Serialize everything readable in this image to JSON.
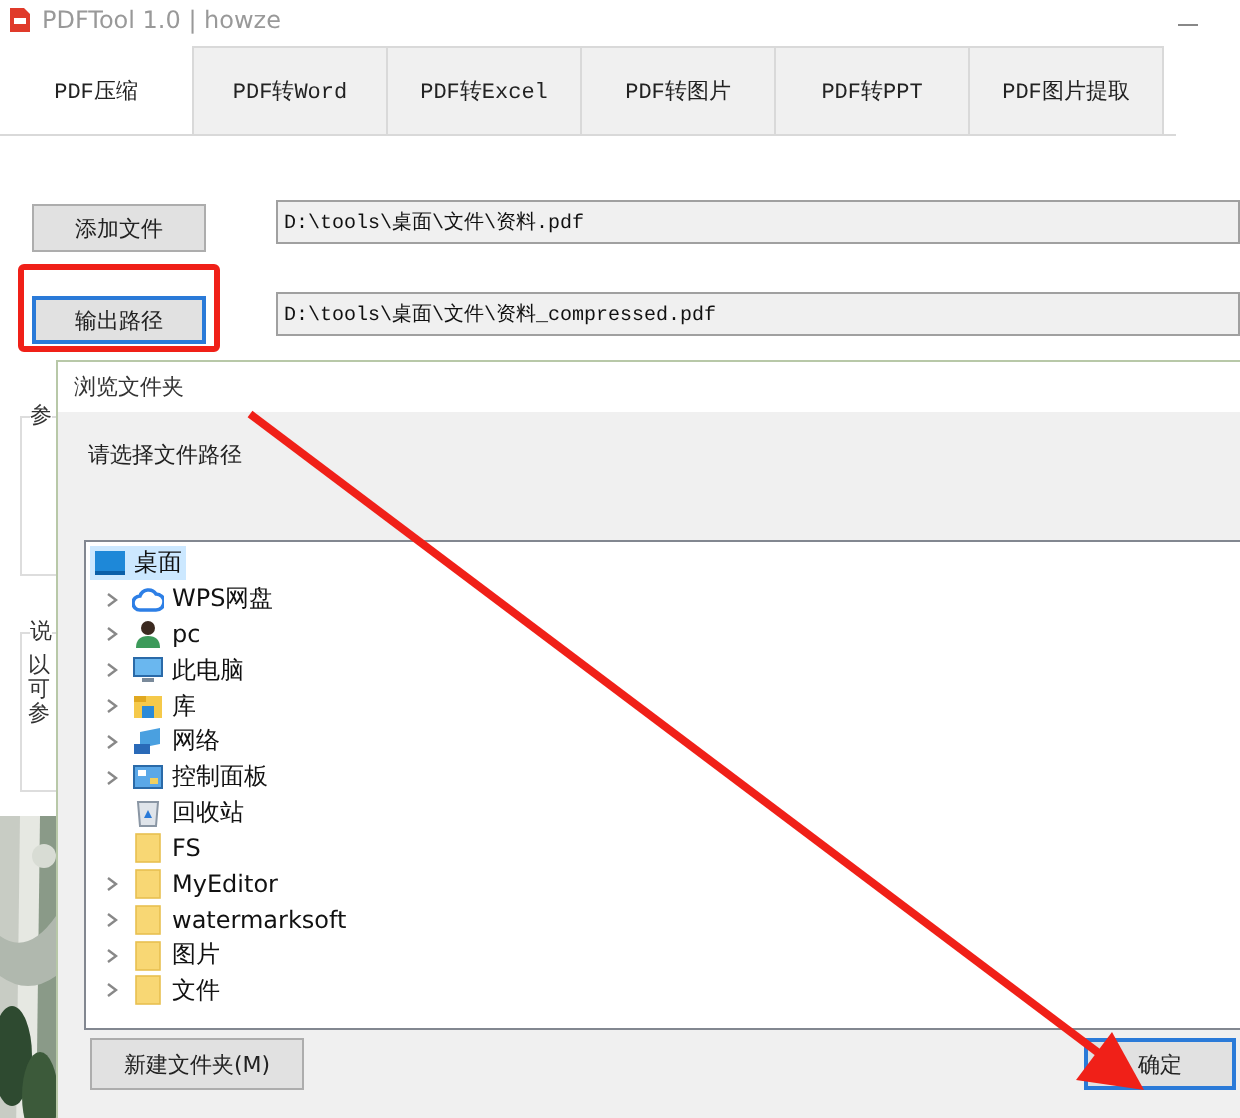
{
  "window": {
    "title": "PDFTool 1.0 | howze"
  },
  "tabs": [
    {
      "label": "PDF压缩",
      "selected": true
    },
    {
      "label": "PDF转Word",
      "selected": false
    },
    {
      "label": "PDF转Excel",
      "selected": false
    },
    {
      "label": "PDF转图片",
      "selected": false
    },
    {
      "label": "PDF转PPT",
      "selected": false
    },
    {
      "label": "PDF图片提取",
      "selected": false
    }
  ],
  "file_rows": [
    {
      "button": {
        "label": "添加文件",
        "focused": false
      },
      "path": "D:\\tools\\桌面\\文件\\资料.pdf"
    },
    {
      "button": {
        "label": "输出路径",
        "focused": true
      },
      "path": "D:\\tools\\桌面\\文件\\资料_compressed.pdf"
    }
  ],
  "groups": [
    {
      "title": "参"
    },
    {
      "title": "说",
      "lines": [
        "以",
        "可",
        "参"
      ]
    }
  ],
  "dialog": {
    "title": "浏览文件夹",
    "prompt": "请选择文件路径",
    "tree": [
      {
        "label": "桌面",
        "kind": "desktop",
        "selected": true,
        "children": [
          {
            "label": "WPS网盘",
            "kind": "cloud",
            "expandable": true,
            "selected": false
          },
          {
            "label": "pc",
            "kind": "user",
            "expandable": true,
            "selected": false
          },
          {
            "label": "此电脑",
            "kind": "computer",
            "expandable": true,
            "selected": false
          },
          {
            "label": "库",
            "kind": "library",
            "expandable": true,
            "selected": false
          },
          {
            "label": "网络",
            "kind": "network",
            "expandable": true,
            "selected": false
          },
          {
            "label": "控制面板",
            "kind": "control-panel",
            "expandable": true,
            "selected": false
          },
          {
            "label": "回收站",
            "kind": "recycle-bin",
            "expandable": false,
            "selected": false
          },
          {
            "label": "FS",
            "kind": "folder",
            "expandable": false,
            "selected": false
          },
          {
            "label": "MyEditor",
            "kind": "folder",
            "expandable": true,
            "selected": false
          },
          {
            "label": "watermarksoft",
            "kind": "folder",
            "expandable": true,
            "selected": false
          },
          {
            "label": "图片",
            "kind": "folder",
            "expandable": true,
            "selected": false
          },
          {
            "label": "文件",
            "kind": "folder",
            "expandable": true,
            "selected": false
          }
        ]
      }
    ],
    "buttons": [
      {
        "label": "新建文件夹(M)",
        "focused": false
      },
      {
        "label": "确定",
        "focused": true
      }
    ]
  }
}
